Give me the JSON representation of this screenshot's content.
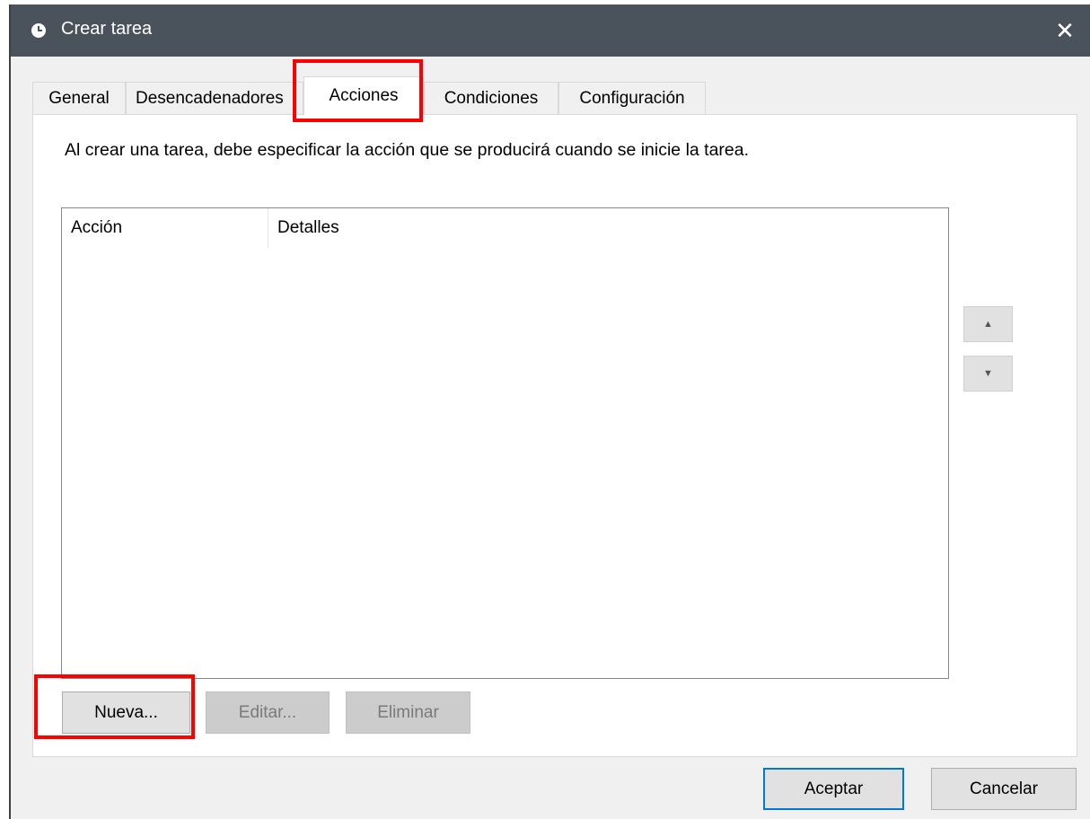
{
  "window": {
    "title": "Crear tarea",
    "close_symbol": "✕"
  },
  "tabs": [
    {
      "label": "General"
    },
    {
      "label": "Desencadenadores"
    },
    {
      "label": "Acciones"
    },
    {
      "label": "Condiciones"
    },
    {
      "label": "Configuración"
    }
  ],
  "active_tab": "Acciones",
  "panel": {
    "description": "Al crear una tarea, debe especificar la acción que se producirá cuando se inicie la tarea.",
    "columns": [
      "Acción",
      "Detalles"
    ],
    "rows": []
  },
  "buttons": {
    "move_up_icon": "arrow-up",
    "move_down_icon": "arrow-down",
    "new": "Nueva...",
    "edit": "Editar...",
    "delete": "Eliminar",
    "ok": "Aceptar",
    "cancel": "Cancelar"
  },
  "colors": {
    "titlebar": "#4a535b",
    "highlight": "#ff0000",
    "default_button_border": "#0078d7"
  }
}
